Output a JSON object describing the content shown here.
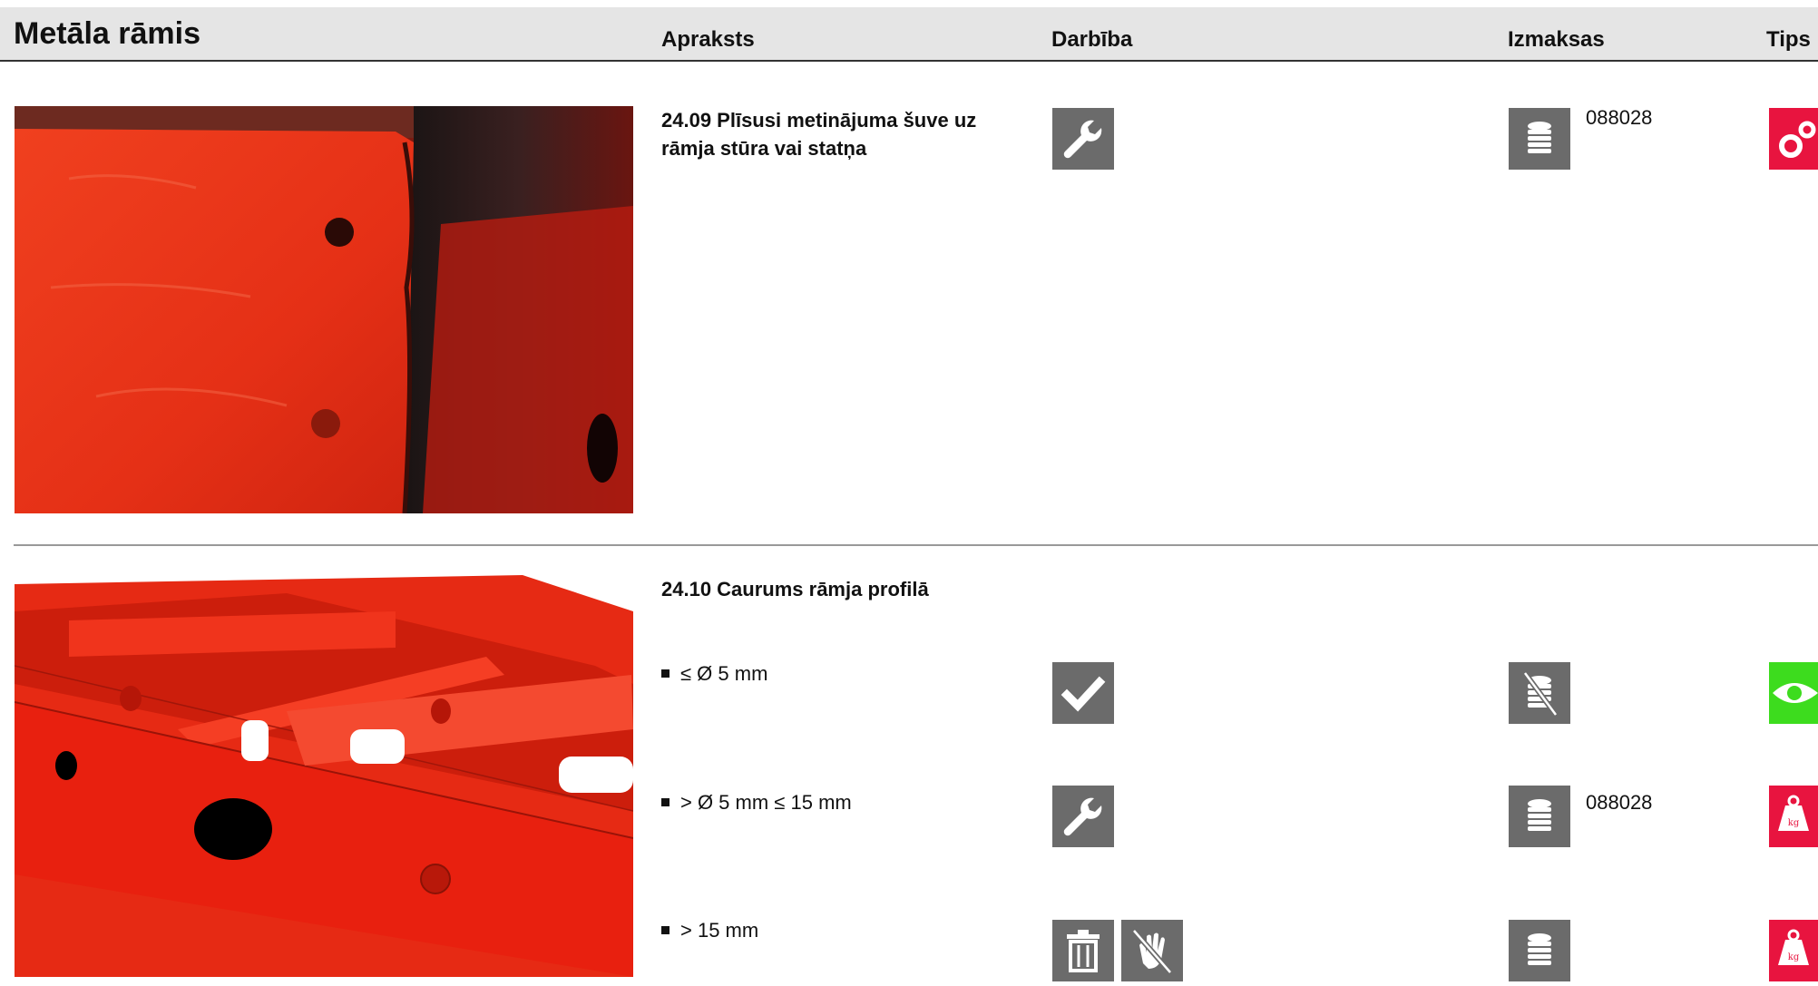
{
  "header": {
    "title": "Metāla rāmis",
    "col_description": "Apraksts",
    "col_action": "Darbība",
    "col_cost": "Izmaksas",
    "col_tips": "Tips"
  },
  "entries": [
    {
      "title": "24.09 Plīsusi metinājuma šuve uz rāmja stūra vai statņa",
      "rows": [
        {
          "action_icons": [
            "wrench-icon"
          ],
          "cost_icon": "coins-icon",
          "cost_code": "088028",
          "tip_icon": "gears-icon",
          "tip_color": "#e8143f"
        }
      ]
    },
    {
      "title": "24.10 Caurums rāmja profilā",
      "rows": [
        {
          "condition": "≤ Ø 5 mm",
          "action_icons": [
            "check-icon"
          ],
          "cost_icon": "coins-crossed-icon",
          "cost_code": "",
          "tip_icon": "eye-icon",
          "tip_color": "#3ddc1e"
        },
        {
          "condition": "> Ø 5 mm ≤ 15 mm",
          "action_icons": [
            "wrench-icon"
          ],
          "cost_icon": "coins-icon",
          "cost_code": "088028",
          "tip_icon": "weight-kg-icon",
          "tip_color": "#e8143f"
        },
        {
          "condition": "> 15 mm",
          "action_icons": [
            "trash-icon",
            "hand-crossed-icon"
          ],
          "cost_icon": "coins-icon",
          "cost_code": "",
          "tip_icon": "weight-kg-icon",
          "tip_color": "#e8143f"
        }
      ]
    }
  ],
  "tip_weight_label": "kg",
  "colors": {
    "icon_gray": "#6b6b6b",
    "tip_red": "#e8143f",
    "tip_green": "#3ddc1e",
    "frame_red": "#e8200f"
  }
}
